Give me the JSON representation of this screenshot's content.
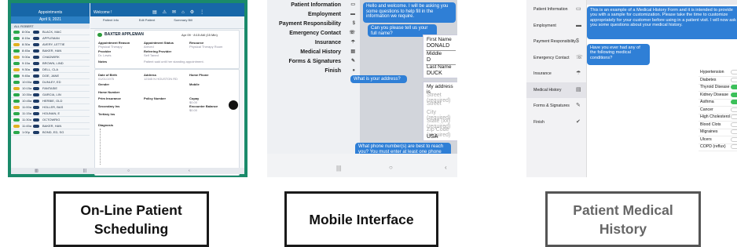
{
  "scheduling": {
    "left_title": "Appointments",
    "left_date": "April 9, 2021",
    "left_header": "ALL ROBERT",
    "appointments": [
      {
        "time": "8:00a",
        "name": "BLACK, MAC",
        "dot": "#2aa84a"
      },
      {
        "time": "8:15a",
        "name": "APPLEMAN",
        "dot": "#2aa84a"
      },
      {
        "time": "8:30a",
        "name": "AVERY, LETTIE",
        "dot": "#e0b020"
      },
      {
        "time": "8:45a",
        "name": "BAKER, HAN",
        "dot": "#2aa84a"
      },
      {
        "time": "9:00a",
        "name": "CHADWIRK",
        "dot": "#e0b020"
      },
      {
        "time": "9:15a",
        "name": "BROWN, LIND",
        "dot": "#2aa84a"
      },
      {
        "time": "9:30a",
        "name": "DELL, CLA",
        "dot": "#e0b020"
      },
      {
        "time": "9:45a",
        "name": "DOE, JANE",
        "dot": "#2aa84a"
      },
      {
        "time": "10:00a",
        "name": "DUNLEY, ED",
        "dot": "#2aa84a"
      },
      {
        "time": "10:15a",
        "name": "FANTASIE",
        "dot": "#e0b020"
      },
      {
        "time": "10:30a",
        "name": "GARCIA, LIN",
        "dot": "#2aa84a"
      },
      {
        "time": "10:45a",
        "name": "HERBIE, OLD",
        "dot": "#2aa84a"
      },
      {
        "time": "11:00a",
        "name": "HOLLER, BAS",
        "dot": "#e0b020"
      },
      {
        "time": "11:15a",
        "name": "HOUNAN, E",
        "dot": "#2aa84a"
      },
      {
        "time": "11:30a",
        "name": "OCTOWRIG",
        "dot": "#2aa84a"
      },
      {
        "time": "11:45a",
        "name": "BAKER, HAN",
        "dot": "#e0b020"
      },
      {
        "time": "1:00p",
        "name": "BOND, ED, SG",
        "dot": "#2aa84a"
      }
    ],
    "right_title": "Welcome !",
    "tabs": [
      "Patient Info",
      "Edit Patient",
      "Summary Bill"
    ],
    "patient_name": "BAXTER APPLEMAN",
    "patient_date": "Apr 09 · 8:15 AM (15 Min)",
    "fields": [
      {
        "label": "Appointment Reason",
        "value": "Physical Therapy"
      },
      {
        "label": "Appointment Status",
        "value": "Arrived"
      },
      {
        "label": "Resource",
        "value": "Physical Therapy Room"
      },
      {
        "label": "Provider",
        "value": "Dr. Lewis"
      },
      {
        "label": "Referring Provider",
        "value": "Self Taned"
      },
      {
        "label": "Notes",
        "value": "Patient said until her standing appointment."
      }
    ],
    "details": [
      {
        "label": "Date of Birth",
        "value": "01/01/1975"
      },
      {
        "label": "Address",
        "value": "12345 N HOUSTON RD"
      },
      {
        "label": "Home Phone",
        "value": ""
      },
      {
        "label": "Gender",
        "value": "Male"
      },
      {
        "label": "Mobile",
        "value": ""
      },
      {
        "label": "Home Number",
        "value": ""
      },
      {
        "label": "Prim Insurance",
        "value": "Primary Ins"
      },
      {
        "label": "Policy Number",
        "value": ""
      },
      {
        "label": "Copay",
        "value": "$0.00"
      },
      {
        "label": "Secondary Ins",
        "value": ""
      },
      {
        "label": "Tertiary Ins",
        "value": ""
      },
      {
        "label": "Encounter Balance",
        "value": "$0.00"
      }
    ],
    "diagnosis_label": "Diagnosis"
  },
  "mobile": {
    "menu": [
      {
        "label": "Patient Information",
        "icon": "▭"
      },
      {
        "label": "Employment",
        "icon": "▬"
      },
      {
        "label": "Payment Responsibility",
        "icon": "$"
      },
      {
        "label": "Emergency Contact",
        "icon": "☏"
      },
      {
        "label": "Insurance",
        "icon": "☂"
      },
      {
        "label": "Medical History",
        "icon": "▤"
      },
      {
        "label": "Forms & Signatures",
        "icon": "✎"
      },
      {
        "label": "Finish",
        "icon": "●"
      }
    ],
    "welcome": "Hello and welcome. I will be asking you some questions to help fill in the information we require.",
    "q_name": "Can you please tell us your full name?",
    "first_label": "First Name",
    "first_value": "DONALD",
    "middle_label": "Middle",
    "middle_value": "D",
    "last_label": "Last Name",
    "last_value": "DUCK",
    "q_address": "What is your address?",
    "addr_label": "My address is",
    "addr_placeholders": [
      "Street (required)",
      "Street",
      "City (required)",
      "State (xx) (required)",
      "Zip Code (required)"
    ],
    "country": "USA",
    "q_phone": "What phone number(s) are best to reach you? You must enter at least one phone number."
  },
  "history": {
    "menu": [
      {
        "label": "Patient Information",
        "icon": "▭",
        "selected": false
      },
      {
        "label": "Employment",
        "icon": "▬",
        "selected": false
      },
      {
        "label": "Payment Responsibility",
        "icon": "$",
        "selected": false
      },
      {
        "label": "Emergency Contact",
        "icon": "☏",
        "selected": false
      },
      {
        "label": "Insurance",
        "icon": "☂",
        "selected": false
      },
      {
        "label": "Medical History",
        "icon": "▤",
        "selected": true
      },
      {
        "label": "Forms & Signatures",
        "icon": "✎",
        "selected": false
      },
      {
        "label": "Finish",
        "icon": "✔",
        "selected": false
      }
    ],
    "intro": "This is an example of a Medical History Form and it is intended to provide you with a sample for customization. Please take the time to customize appropriately for your customer before using in a patient visit. I will now ask you some questions about your medical history.",
    "question": "Have you ever had any of the following medical conditions?",
    "conditions": [
      {
        "label": "Hypertension",
        "on": false
      },
      {
        "label": "Diabetes",
        "on": false
      },
      {
        "label": "Thyroid Disease",
        "on": true
      },
      {
        "label": "Kidney Disease",
        "on": true
      },
      {
        "label": "Asthma",
        "on": true
      },
      {
        "label": "Cancer",
        "on": false
      },
      {
        "label": "High Cholesterol",
        "on": false
      },
      {
        "label": "Blood Clots",
        "on": false
      },
      {
        "label": "Migraines",
        "on": false
      },
      {
        "label": "Ulcers",
        "on": false
      },
      {
        "label": "COPD (reflux)",
        "on": false
      }
    ]
  },
  "captions": {
    "c1_line1": "On-Line Patient",
    "c1_line2": "Scheduling",
    "c2": "Mobile Interface",
    "c3_line1": "Patient Medical",
    "c3_line2": "History"
  }
}
